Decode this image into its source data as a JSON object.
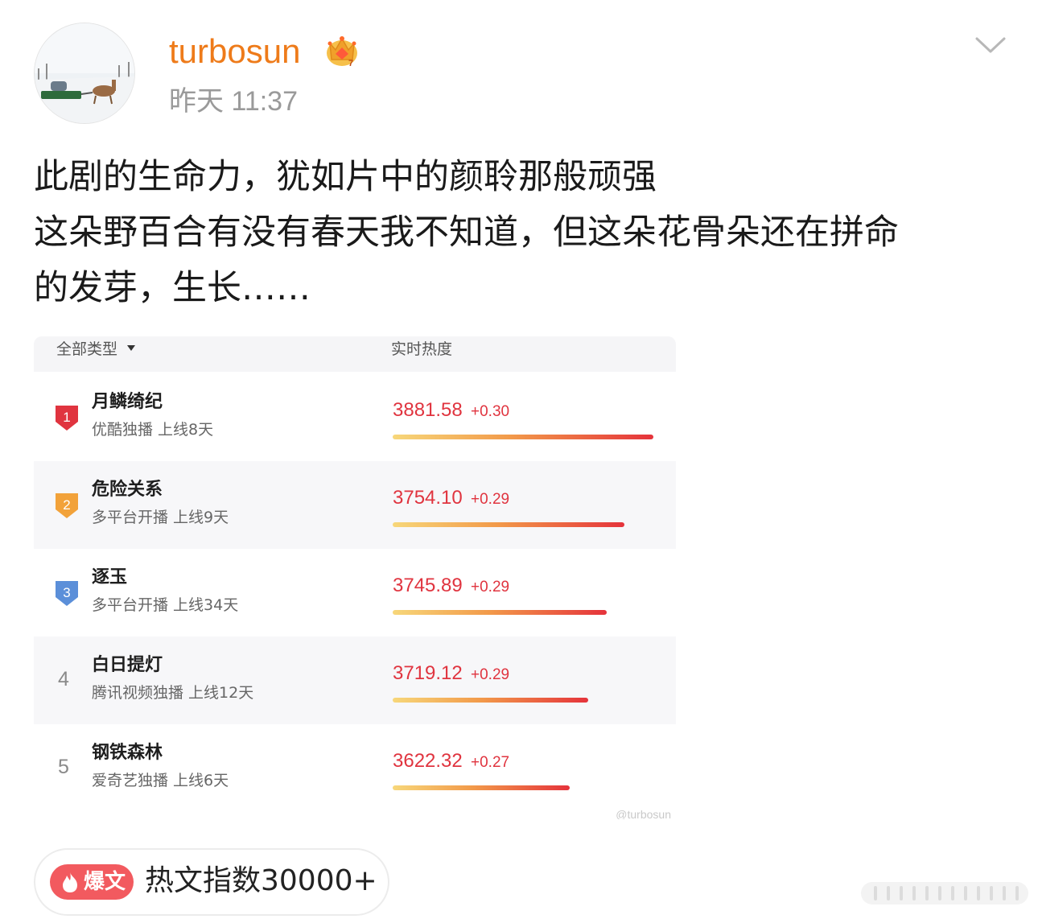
{
  "post": {
    "username": "turbosun",
    "timestamp": "昨天 11:37",
    "text_lines": [
      "此剧的生命力，犹如片中的颜聆那般顽强",
      "这朵野百合有没有春天我不知道，但这朵花骨朵还在拼命",
      "的发芽，生长……"
    ],
    "icons": {
      "avatar": "avatar-photo-sleigh",
      "crown": "crown-icon",
      "menu": "chevron-down-icon"
    }
  },
  "ranking": {
    "filter_label": "全部类型",
    "column_label": "实时热度",
    "watermark": "@turbosun",
    "rows": [
      {
        "rank": "1",
        "title": "月鳞绮纪",
        "subtitle": "优酷独播 上线8天",
        "score": "3881.58",
        "delta": "+0.30",
        "heat_fraction": 1.0,
        "badge_color": "#e0343f"
      },
      {
        "rank": "2",
        "title": "危险关系",
        "subtitle": "多平台开播 上线9天",
        "score": "3754.10",
        "delta": "+0.29",
        "heat_fraction": 0.89,
        "badge_color": "#f2a23a"
      },
      {
        "rank": "3",
        "title": "逐玉",
        "subtitle": "多平台开播 上线34天",
        "score": "3745.89",
        "delta": "+0.29",
        "heat_fraction": 0.82,
        "badge_color": "#5b8fd9"
      },
      {
        "rank": "4",
        "title": "白日提灯",
        "subtitle": "腾讯视频独播 上线12天",
        "score": "3719.12",
        "delta": "+0.29",
        "heat_fraction": 0.75,
        "badge_color": ""
      },
      {
        "rank": "5",
        "title": "钢铁森林",
        "subtitle": "爱奇艺独播 上线6天",
        "score": "3622.32",
        "delta": "+0.27",
        "heat_fraction": 0.68,
        "badge_color": ""
      }
    ]
  },
  "hot_badge": {
    "tag": "爆文",
    "index_text": "热文指数30000+",
    "tag_color": "#f25a5f"
  },
  "colors": {
    "username": "#ee7b1a",
    "accent_red": "#e0343f"
  }
}
